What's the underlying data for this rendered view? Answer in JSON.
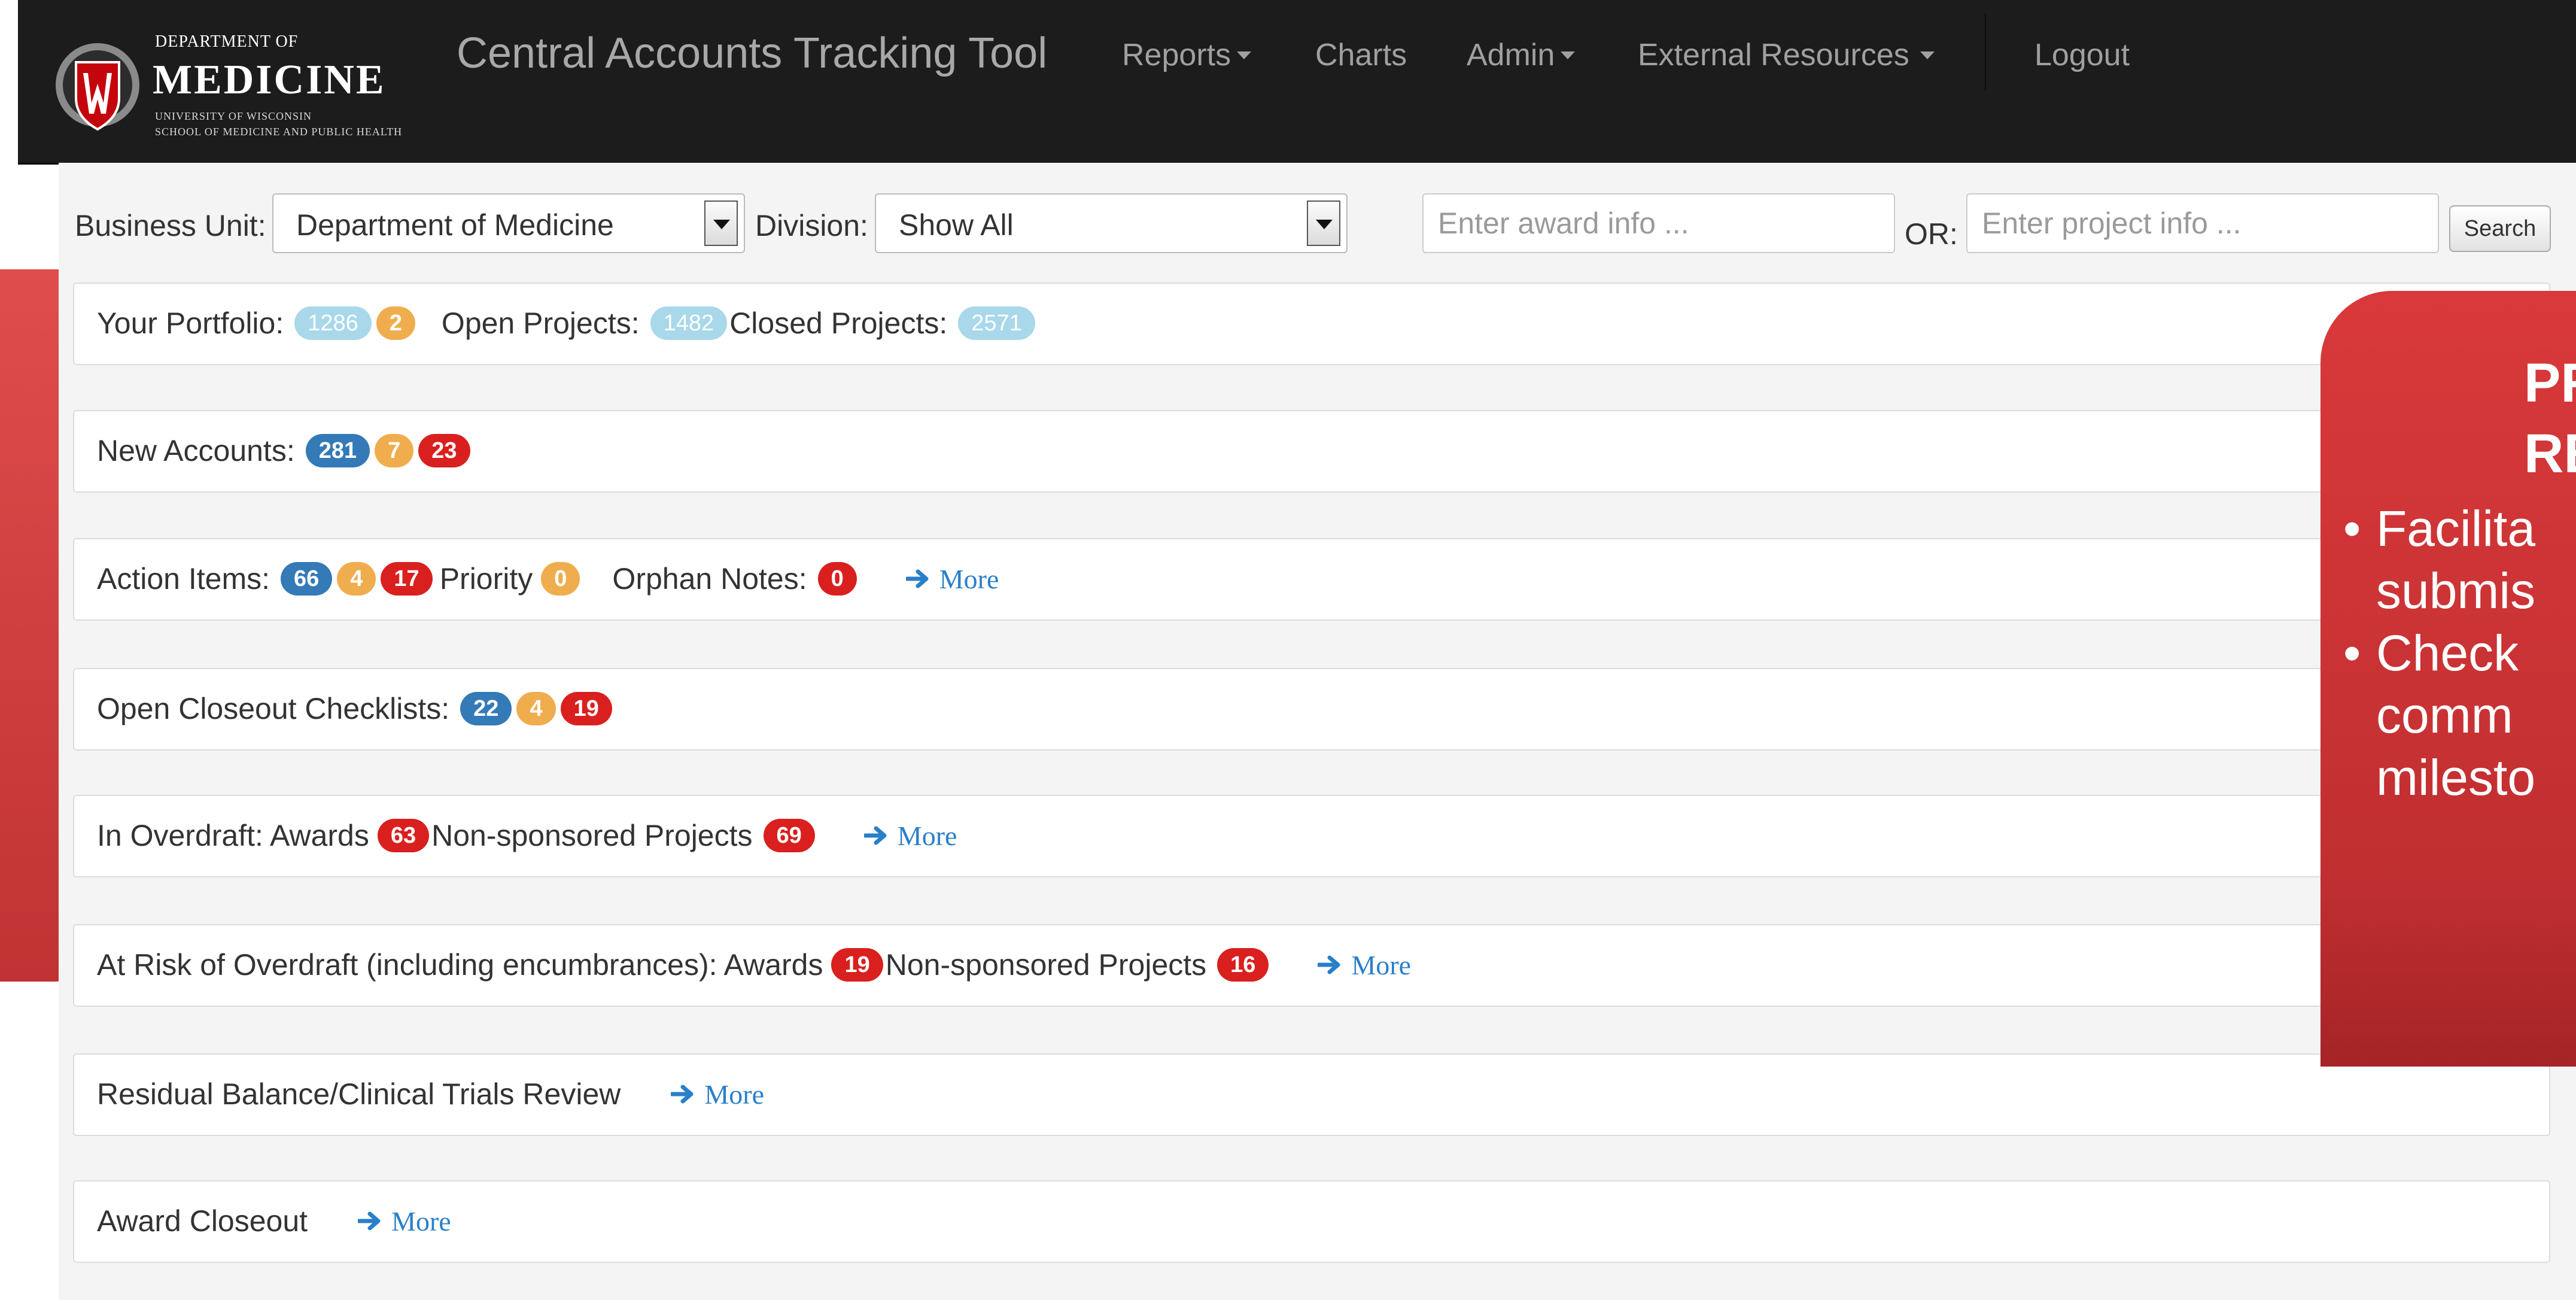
{
  "logo": {
    "dept_line": "DEPARTMENT OF",
    "main_line": "MEDICINE",
    "uw_line": "UNIVERSITY OF WISCONSIN",
    "school_line": "SCHOOL OF MEDICINE AND PUBLIC HEALTH"
  },
  "navbar": {
    "brand": "Central Accounts Tracking Tool",
    "items": [
      {
        "label": "Reports",
        "dropdown": true
      },
      {
        "label": "Charts",
        "dropdown": false
      },
      {
        "label": "Admin",
        "dropdown": true
      },
      {
        "label": "External Resources",
        "dropdown": true
      },
      {
        "label": "Logout",
        "dropdown": false
      }
    ]
  },
  "filters": {
    "business_unit_label": "Business Unit:",
    "business_unit_value": "Department of Medicine",
    "division_label": "Division:",
    "division_value": "Show All",
    "award_placeholder": "Enter award info ...",
    "or_label": "OR:",
    "project_placeholder": "Enter project info ...",
    "search_label": "Search"
  },
  "panels": {
    "portfolio": {
      "label": "Your Portfolio:",
      "badge1": "1286",
      "badge2": "2",
      "open_label": "Open Projects:",
      "open_count": "1482",
      "closed_label": "Closed Projects:",
      "closed_count": "2571"
    },
    "new_accounts": {
      "label": "New Accounts:",
      "b1": "281",
      "b2": "7",
      "b3": "23"
    },
    "action_items": {
      "label": "Action Items:",
      "b1": "66",
      "b2": "4",
      "b3": "17",
      "priority_label": "Priority",
      "priority_count": "0",
      "orphan_label": "Orphan Notes:",
      "orphan_count": "0",
      "more": "More"
    },
    "closeout_checklists": {
      "label": "Open Closeout Checklists:",
      "b1": "22",
      "b2": "4",
      "b3": "19"
    },
    "overdraft": {
      "label": "In Overdraft: Awards",
      "awards": "63",
      "nonsponsored_label": "Non-sponsored Projects",
      "nonsponsored": "69",
      "more": "More"
    },
    "at_risk": {
      "label": "At Risk of Overdraft (including encumbrances): Awards",
      "awards": "19",
      "nonsponsored_label": "Non-sponsored Projects",
      "nonsponsored": "16",
      "more": "More"
    },
    "residual": {
      "label": "Residual Balance/Clinical Trials Review",
      "more": "More"
    },
    "award_closeout": {
      "label": "Award Closeout",
      "more": "More"
    }
  },
  "callout": {
    "title_line1": "PRO",
    "title_line2": "RE",
    "bullet1_line1": "Facilita",
    "bullet1_line2": "submis",
    "bullet2_line1": "Check",
    "bullet2_line2": "comm",
    "bullet2_line3": "milesto"
  },
  "colors": {
    "navbar_bg": "#1c1c1c",
    "badge_blue": "#337ab7",
    "badge_orange": "#f0ad4e",
    "badge_red": "#d9201e",
    "badge_light": "#a8d8ea",
    "link_blue": "#2a7fc9",
    "callout_red": "#d9393b"
  },
  "icons": {
    "more_link": "arrow-right-icon",
    "dropdown": "caret-down-icon",
    "logo": "wisconsin-shield-icon"
  }
}
